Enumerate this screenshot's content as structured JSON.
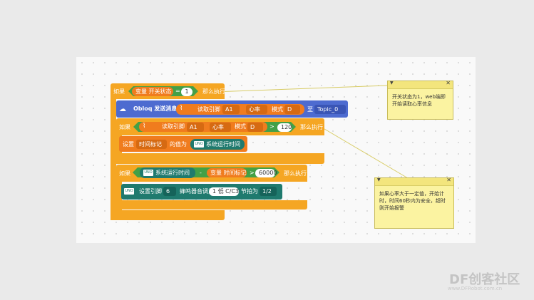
{
  "blocks": {
    "if1": {
      "kw": "如果",
      "var": "变量 开关状态",
      "eq": "=",
      "val": "1",
      "then": "那么执行"
    },
    "obloq": {
      "title": "Obloq 发送消息",
      "read": "读取引脚",
      "pin": "A1",
      "heart": "心率",
      "mode_lbl": "模式",
      "mode": "D",
      "to": "至",
      "topic": "Topic_0"
    },
    "if2": {
      "kw": "如果",
      "read": "读取引脚",
      "pin": "A1",
      "heart": "心率",
      "mode_lbl": "模式",
      "mode": "D",
      "gt": ">",
      "val": "120",
      "then": "那么执行"
    },
    "set1": {
      "set": "设置",
      "var": "时间标记",
      "value_of": "的值为",
      "runtime": "系统运行时间"
    },
    "if3": {
      "kw": "如果",
      "runtime": "系统运行时间",
      "minus": "-",
      "var": "变量 时间标记",
      "gt": ">",
      "val": "60000",
      "then": "那么执行"
    },
    "tone": {
      "set": "设置引脚",
      "pin": "6",
      "tone_lbl": "蜂鸣器音调为",
      "note": "1 低 C/C3",
      "beat_lbl": "节拍为",
      "beat": "1/2"
    }
  },
  "notes": [
    {
      "text": "开关状态为1，web端即开始读取心率信息"
    },
    {
      "text": "如果心率大于一定值，开始计时，时间60秒内为安全，超时则开始报警"
    }
  ],
  "watermark": {
    "brand": "DF创客社区",
    "url": "www.DFRobot.com.cn"
  },
  "icons": {
    "uno": "UNO"
  }
}
